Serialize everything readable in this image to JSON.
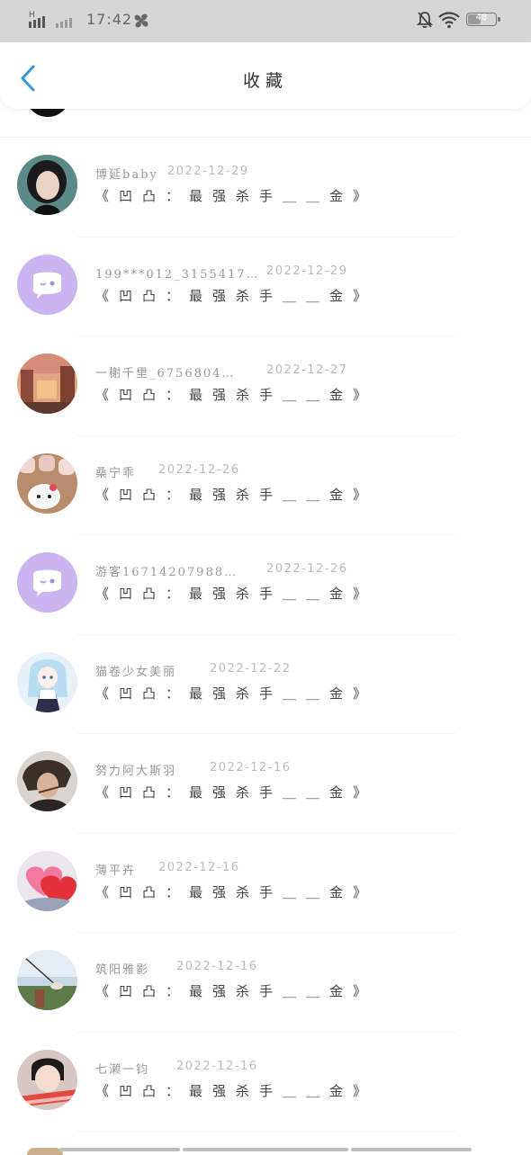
{
  "status_bar": {
    "time": "17:42",
    "network_label": "H",
    "battery_text": "48",
    "battery_level": 0.48
  },
  "header": {
    "title": "收藏",
    "back_icon": "chevron-left-icon",
    "accent_color": "#2f9ae0"
  },
  "favorites": [
    {
      "name": "博延baby",
      "date": "2022-12-29",
      "title": "《凹凸：最强杀手＿＿金》",
      "avatar": "photo-girl-dark-hair"
    },
    {
      "name": "199***012_3155417…",
      "date": "2022-12-29",
      "title": "《凹凸：最强杀手＿＿金》",
      "avatar": "default-chat-bubble"
    },
    {
      "name": "一榭千里_6756804…",
      "date": "2022-12-27",
      "title": "《凹凸：最强杀手＿＿金》",
      "avatar": "photo-sunset-street"
    },
    {
      "name": "桑宁乖",
      "date": "2022-12-26",
      "title": "《凹凸：最强杀手＿＿金》",
      "avatar": "photo-hello-kitty-mugs"
    },
    {
      "name": "游客16714207988…",
      "date": "2022-12-26",
      "title": "《凹凸：最强杀手＿＿金》",
      "avatar": "default-chat-bubble"
    },
    {
      "name": "猫卷少女美丽",
      "date": "2022-12-22",
      "title": "《凹凸：最强杀手＿＿金》",
      "avatar": "anime-girl-light-blue"
    },
    {
      "name": "努力阿大斯羽",
      "date": "2022-12-16",
      "title": "《凹凸：最强杀手＿＿金》",
      "avatar": "anime-boy-dark"
    },
    {
      "name": "薄平卉",
      "date": "2022-12-16",
      "title": "《凹凸：最强杀手＿＿金》",
      "avatar": "photo-pink-hearts"
    },
    {
      "name": "筑阳雅影",
      "date": "2022-12-16",
      "title": "《凹凸：最强杀手＿＿金》",
      "avatar": "photo-person-swinging"
    },
    {
      "name": "七濑一钧",
      "date": "2022-12-16",
      "title": "《凹凸：最强杀手＿＿金》",
      "avatar": "photo-child-red-scarf"
    }
  ]
}
